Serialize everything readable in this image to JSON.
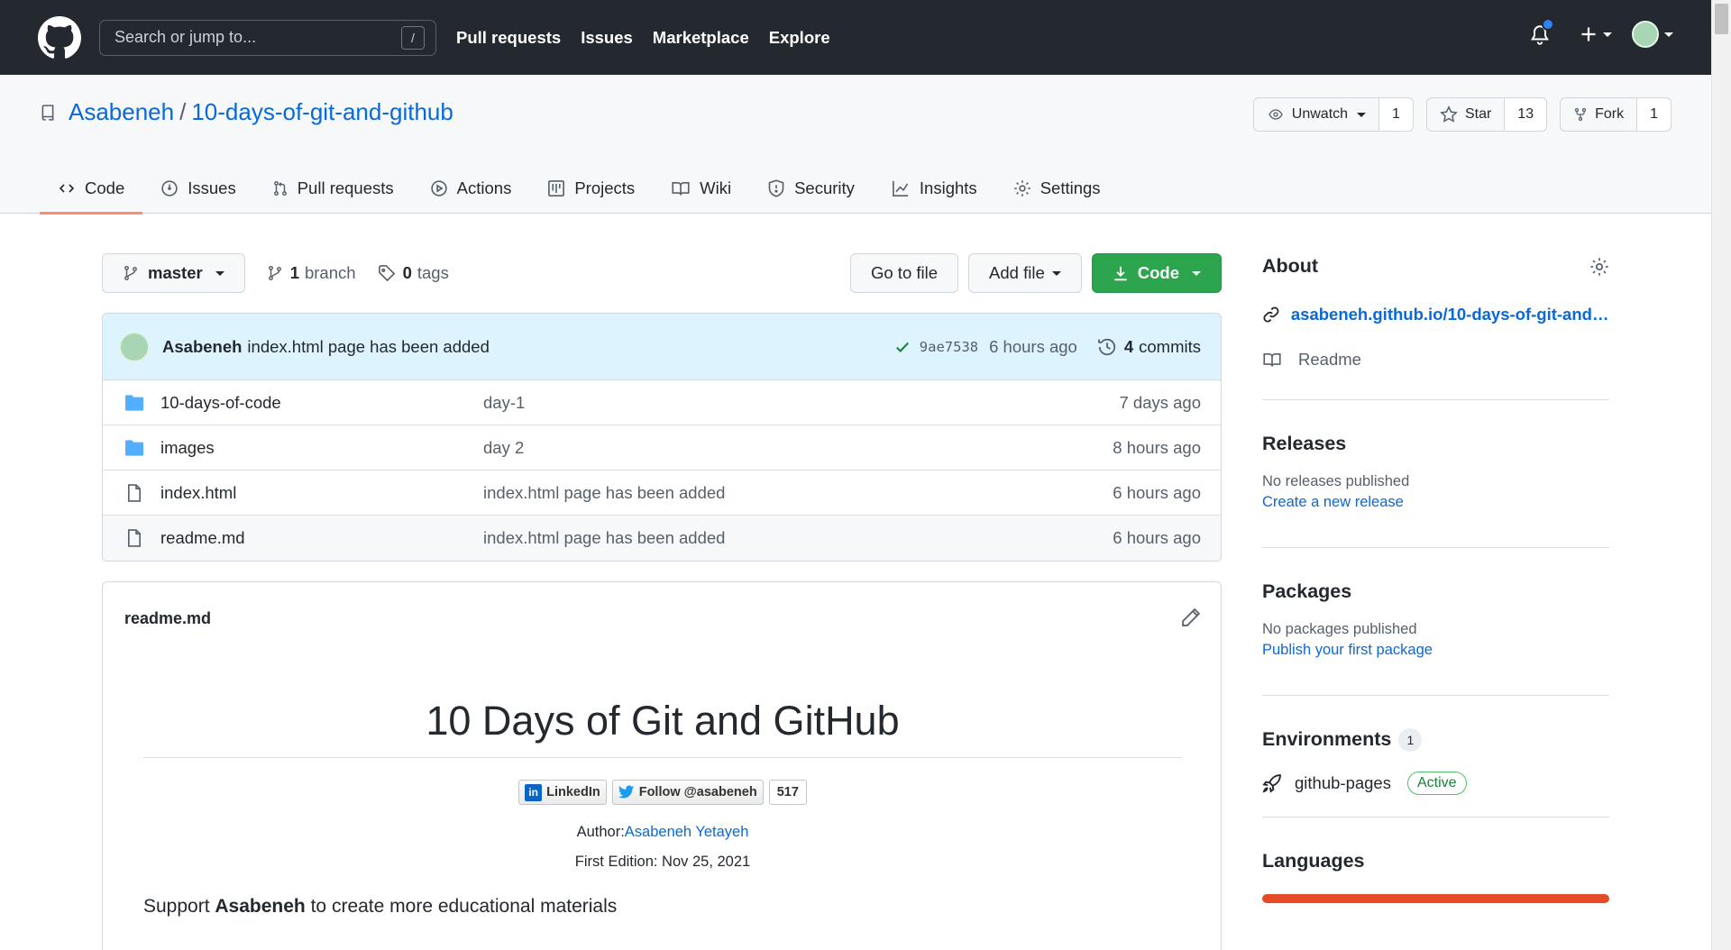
{
  "topbar": {
    "search_placeholder": "Search or jump to...",
    "search_shortcut": "/",
    "nav": [
      "Pull requests",
      "Issues",
      "Marketplace",
      "Explore"
    ]
  },
  "repo": {
    "owner": "Asabeneh",
    "separator": "/",
    "name": "10-days-of-git-and-github",
    "watch_label": "Unwatch",
    "watch_count": "1",
    "star_label": "Star",
    "star_count": "13",
    "fork_label": "Fork",
    "fork_count": "1"
  },
  "tabs": [
    {
      "label": "Code",
      "icon": "code-icon"
    },
    {
      "label": "Issues",
      "icon": "issue-icon"
    },
    {
      "label": "Pull requests",
      "icon": "pull-request-icon"
    },
    {
      "label": "Actions",
      "icon": "play-icon"
    },
    {
      "label": "Projects",
      "icon": "project-icon"
    },
    {
      "label": "Wiki",
      "icon": "book-icon"
    },
    {
      "label": "Security",
      "icon": "shield-icon"
    },
    {
      "label": "Insights",
      "icon": "graph-icon"
    },
    {
      "label": "Settings",
      "icon": "gear-icon"
    }
  ],
  "branchbar": {
    "branch": "master",
    "branch_count": "1",
    "branch_word": "branch",
    "tag_count": "0",
    "tag_word": "tags",
    "go_to_file": "Go to file",
    "add_file": "Add file",
    "code": "Code"
  },
  "latest_commit": {
    "author": "Asabeneh",
    "message": "index.html page has been added",
    "sha": "9ae7538",
    "ago": "6 hours ago",
    "commit_count": "4",
    "commit_word": "commits"
  },
  "files": [
    {
      "type": "folder",
      "name": "10-days-of-code",
      "message": "day-1",
      "time": "7 days ago"
    },
    {
      "type": "folder",
      "name": "images",
      "message": "day 2",
      "time": "8 hours ago"
    },
    {
      "type": "file",
      "name": "index.html",
      "message": "index.html page has been added",
      "time": "6 hours ago"
    },
    {
      "type": "file",
      "name": "readme.md",
      "message": "index.html page has been added",
      "time": "6 hours ago"
    }
  ],
  "readme": {
    "filename": "readme.md",
    "title": "10 Days of Git and GitHub",
    "badge_linkedin": "LinkedIn",
    "badge_twitter": "Follow @asabeneh",
    "badge_twitter_count": "517",
    "author_prefix": "Author:",
    "author_name": "Asabeneh Yetayeh",
    "edition": "First Edition: Nov 25, 2021",
    "support_prefix": "Support ",
    "support_name": "Asabeneh",
    "support_suffix": " to create more educational materials"
  },
  "sidebar": {
    "about_title": "About",
    "about_link": "asabeneh.github.io/10-days-of-git-and-github",
    "readme_label": "Readme",
    "releases_title": "Releases",
    "releases_none": "No releases published",
    "releases_link": "Create a new release",
    "packages_title": "Packages",
    "packages_none": "No packages published",
    "packages_link": "Publish your first package",
    "environments_title": "Environments",
    "environments_count": "1",
    "env_name": "github-pages",
    "env_status": "Active",
    "languages_title": "Languages"
  },
  "colors": {
    "header_bg": "#24292f",
    "link": "#0969da",
    "green_button": "#2da44e",
    "active_tab_underline": "#fd8c73",
    "language_html": "#e34c26"
  }
}
